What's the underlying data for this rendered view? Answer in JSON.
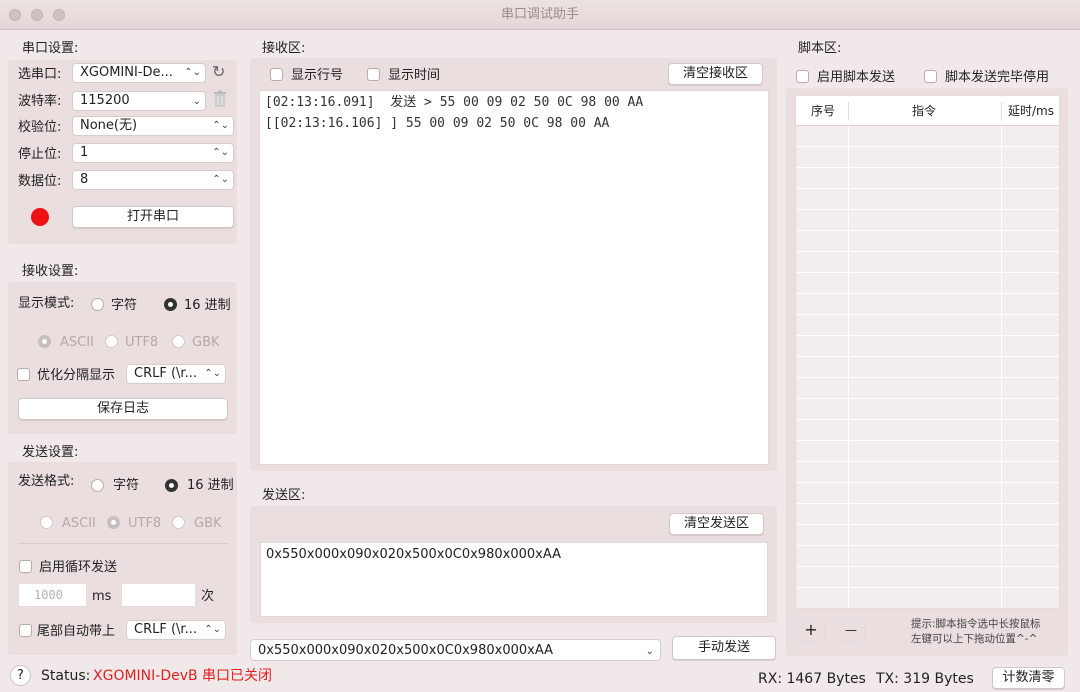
{
  "window": {
    "title": "串口调试助手"
  },
  "serial": {
    "section": "串口设置:",
    "port_label": "选串口:",
    "port_value": "XGOMINI-De...",
    "baud_label": "波特率:",
    "baud_value": "115200",
    "parity_label": "校验位:",
    "parity_value": "None(无)",
    "stop_label": "停止位:",
    "stop_value": "1",
    "data_label": "数据位:",
    "data_value": "8",
    "open_button": "打开串口",
    "status_color": "#ee1111"
  },
  "receive": {
    "section": "接收设置:",
    "display_mode_label": "显示模式:",
    "mode_char": "字符",
    "mode_hex": "16 进制",
    "enc_ascii": "ASCII",
    "enc_utf8": "UTF8",
    "enc_gbk": "GBK",
    "optimize_label": "优化分隔显示",
    "crlf_value": "CRLF (\\r...",
    "save_log": "保存日志"
  },
  "send_settings": {
    "section": "发送设置:",
    "format_label": "发送格式:",
    "mode_char": "字符",
    "mode_hex": "16 进制",
    "enc_ascii": "ASCII",
    "enc_utf8": "UTF8",
    "enc_gbk": "GBK",
    "loop_label": "启用循环发送",
    "interval_placeholder": "1000",
    "ms_unit": "ms",
    "times_unit": "次",
    "auto_append_label": "尾部自动带上",
    "crlf_value": "CRLF (\\r..."
  },
  "recv_area": {
    "section": "接收区:",
    "show_line_no": "显示行号",
    "show_time": "显示时间",
    "clear_button": "清空接收区",
    "lines": [
      "[02:13:16.091]  发送 > 55 00 09 02 50 0C 98 00 AA",
      "[[02:13:16.106] ] 55 00 09 02 50 0C 98 00 AA"
    ]
  },
  "send_area": {
    "section": "发送区:",
    "clear_button": "清空发送区",
    "content": "0x550x000x090x020x500x0C0x980x000xAA",
    "history_value": "0x550x000x090x020x500x0C0x980x000xAA",
    "send_button": "手动发送"
  },
  "script": {
    "section": "脚本区:",
    "enable_label": "启用脚本发送",
    "stop_after_label": "脚本发送完毕停用",
    "col_index": "序号",
    "col_cmd": "指令",
    "col_delay": "延时/ms",
    "add": "+",
    "remove": "—",
    "hint_line1": "提示:脚本指令选中长按鼠标",
    "hint_line2": "左键可以上下拖动位置^-^"
  },
  "statusbar": {
    "help": "?",
    "status_label": "Status:",
    "status_text": "XGOMINI-DevB 串口已关闭",
    "rx": "RX: 1467 Bytes",
    "tx": "TX: 319 Bytes",
    "reset_button": "计数清零"
  }
}
